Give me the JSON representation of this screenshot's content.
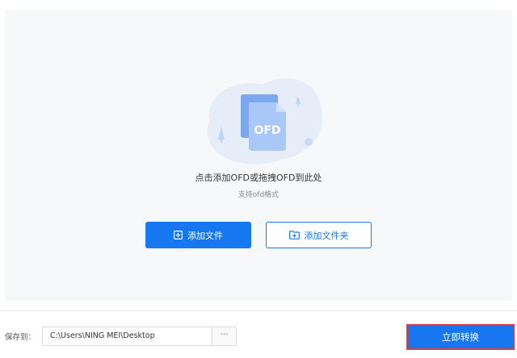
{
  "colors": {
    "primary": "#1677f0",
    "panel_bg": "#f7f8fa",
    "highlight_border": "#e0383e"
  },
  "drop_zone": {
    "illustration_label": "OFD",
    "title": "点击添加OFD或拖拽OFD到此处",
    "subtitle": "支持ofd格式"
  },
  "actions": {
    "add_file_label": "添加文件",
    "add_file_icon": "plus-square-icon",
    "add_folder_label": "添加文件夹",
    "add_folder_icon": "folder-plus-icon"
  },
  "footer": {
    "save_to_label": "保存到：",
    "save_path": "C:\\Users\\NING MEI\\Desktop",
    "browse_label": "···",
    "convert_label": "立即转换"
  }
}
